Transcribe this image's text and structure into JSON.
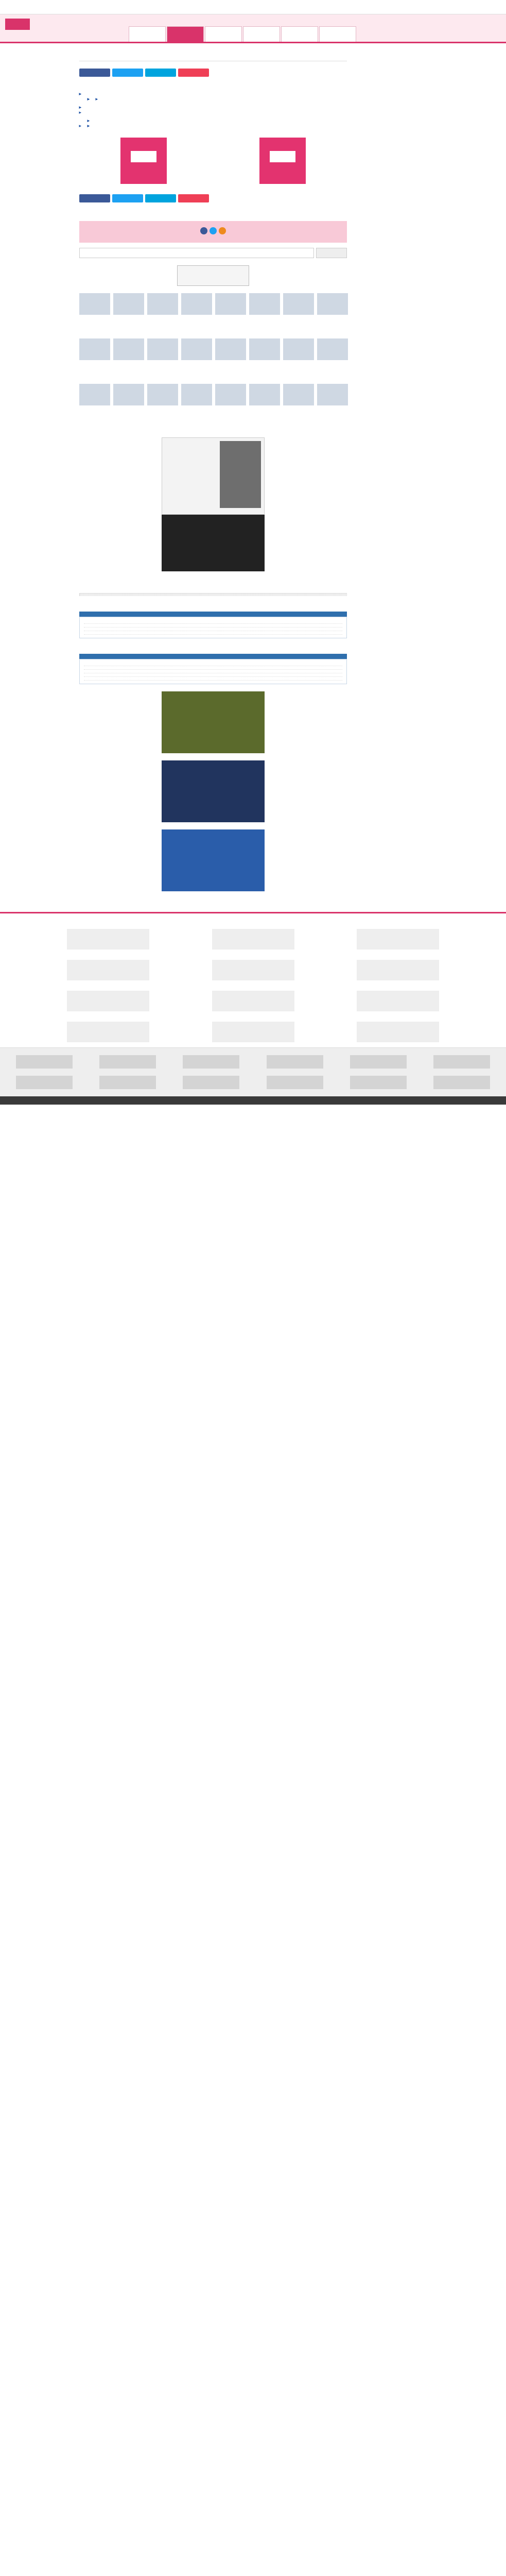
{
  "browser": {
    "url": ""
  },
  "header": {
    "nav": [
      {
        "label": ""
      },
      {
        "label": ""
      },
      {
        "label": ""
      },
      {
        "label": ""
      },
      {
        "label": ""
      },
      {
        "label": ""
      }
    ]
  },
  "breadcrumb": "",
  "page": {
    "title": "",
    "meta": ""
  },
  "sitemap": {
    "top": [
      {
        "label": ""
      },
      {
        "label": ""
      },
      {
        "label": ""
      }
    ],
    "content_label": "",
    "content_items": [
      {
        "label": ""
      },
      {
        "label": ""
      },
      {
        "label": ""
      }
    ],
    "ranking_label": "",
    "ranking_sub": [
      {
        "label": ""
      },
      {
        "label": ""
      }
    ],
    "content_more": [
      {
        "label": ""
      },
      {
        "label": ""
      }
    ],
    "group2": [
      {
        "label": ""
      },
      {
        "label": ""
      },
      {
        "label": ""
      }
    ],
    "group3": [
      {
        "label": ""
      }
    ],
    "about_label": "",
    "about_items": [
      {
        "label": ""
      },
      {
        "label": ""
      },
      {
        "label": ""
      }
    ],
    "group4": [
      {
        "label": ""
      }
    ],
    "company_label": "",
    "company_items": [
      {
        "label": ""
      },
      {
        "label": ""
      }
    ],
    "account_label": "",
    "account_items": [
      {
        "label": ""
      },
      {
        "label": ""
      },
      {
        "label": ""
      }
    ],
    "account_note": ""
  },
  "promos": [
    {
      "label": "",
      "caption": ""
    },
    {
      "label": "",
      "caption": ""
    }
  ],
  "pink_box": {
    "text": ""
  },
  "links_list": [
    {
      "label": ""
    },
    {
      "label": ""
    },
    {
      "label": ""
    }
  ],
  "search": {
    "placeholder": "",
    "button": ""
  },
  "recommend": {
    "title1": "",
    "row1": [
      {
        "cap": ""
      },
      {
        "cap": ""
      },
      {
        "cap": ""
      },
      {
        "cap": ""
      },
      {
        "cap": ""
      },
      {
        "cap": ""
      },
      {
        "cap": ""
      },
      {
        "cap": ""
      }
    ],
    "title2": "",
    "row2": [
      {
        "cap": ""
      },
      {
        "cap": ""
      },
      {
        "cap": ""
      },
      {
        "cap": ""
      },
      {
        "cap": ""
      },
      {
        "cap": ""
      },
      {
        "cap": ""
      },
      {
        "cap": ""
      }
    ],
    "title3": "",
    "row3": [
      {
        "cap": ""
      },
      {
        "cap": ""
      },
      {
        "cap": ""
      },
      {
        "cap": ""
      },
      {
        "cap": ""
      },
      {
        "cap": ""
      },
      {
        "cap": ""
      },
      {
        "cap": ""
      }
    ]
  },
  "ad_type": {
    "word": ""
  },
  "related": {
    "head": "",
    "items": [
      {
        "label": ""
      },
      {
        "label": ""
      },
      {
        "label": ""
      },
      {
        "label": ""
      },
      {
        "label": ""
      }
    ]
  },
  "news": {
    "head": "",
    "items": [
      {
        "label": ""
      },
      {
        "label": ""
      },
      {
        "label": ""
      },
      {
        "label": ""
      }
    ]
  },
  "topics": {
    "head": "",
    "items": [
      {
        "label": ""
      },
      {
        "label": ""
      },
      {
        "label": ""
      },
      {
        "label": ""
      },
      {
        "label": ""
      }
    ]
  },
  "footer": {
    "sponsor_caption": "",
    "copyright": ""
  }
}
